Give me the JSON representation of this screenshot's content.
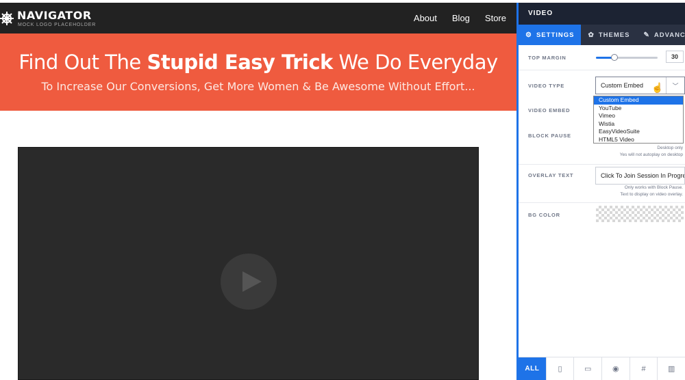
{
  "site": {
    "logo": {
      "title": "NAVIGATOR",
      "subtitle": "MOCK LOGO PLACEHOLDER"
    },
    "nav": [
      "About",
      "Blog",
      "Store"
    ],
    "hero": {
      "headline_pre": "Find Out The ",
      "headline_bold": "Stupid Easy Trick",
      "headline_post": " We Do Everyday",
      "subheadline": "To Increase Our Conversions, Get More Women & Be Awesome Without Effort..."
    },
    "colors": {
      "nav_bg": "#222222",
      "hero_bg": "#ef5b3f",
      "video_bg": "#2a2a2a",
      "accent": "#1e73e8"
    }
  },
  "panel": {
    "title": "VIDEO",
    "tabs": [
      {
        "label": "SETTINGS",
        "icon": "gear-icon",
        "active": true
      },
      {
        "label": "THEMES",
        "icon": "palette-icon",
        "active": false
      },
      {
        "label": "ADVANCED",
        "icon": "wrench-icon",
        "active": false
      }
    ],
    "top_margin": {
      "label": "TOP MARGIN",
      "value": "30",
      "slider_fraction": 0.3
    },
    "video_type": {
      "label": "VIDEO TYPE",
      "selected": "Custom Embed",
      "options": [
        "Custom Embed",
        "YouTube",
        "Vimeo",
        "Wistia",
        "EasyVideoSuite",
        "HTML5 Video"
      ]
    },
    "video_embed": {
      "label": "VIDEO EMBED"
    },
    "block_pause": {
      "label": "BLOCK PAUSE",
      "help_line1": "Desktop only",
      "help_line2": "Yes will not autoplay on desktop"
    },
    "overlay_text": {
      "label": "OVERLAY TEXT",
      "value": "Click To Join Session In Progress",
      "help_line1": "Only works with Block Pause.",
      "help_line2": "Text to display on video overlay."
    },
    "bg_color": {
      "label": "BG COLOR"
    },
    "footer": {
      "all_label": "ALL",
      "icons": [
        "mobile-icon",
        "desktop-icon",
        "eye-icon",
        "hash-icon",
        "trash-icon"
      ]
    }
  }
}
